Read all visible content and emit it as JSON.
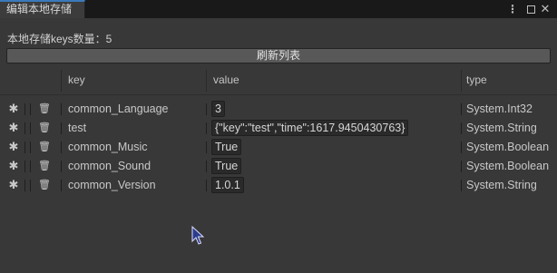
{
  "window": {
    "tab_title": "编辑本地存储",
    "controls": {
      "menu": "⋮",
      "maximize": "□",
      "close": "✕"
    }
  },
  "summary": {
    "count_text": "本地存储keys数量：5"
  },
  "toolbar": {
    "refresh_label": "刷新列表"
  },
  "table": {
    "headers": {
      "key": "key",
      "value": "value",
      "type": "type"
    },
    "rows": [
      {
        "key": "common_Language",
        "value": "3",
        "type": "System.Int32"
      },
      {
        "key": "test",
        "value": "{\"key\":\"test\",\"time\":1617.9450430763}",
        "type": "System.String"
      },
      {
        "key": "common_Music",
        "value": "True",
        "type": "System.Boolean"
      },
      {
        "key": "common_Sound",
        "value": "True",
        "type": "System.Boolean"
      },
      {
        "key": "common_Version",
        "value": "1.0.1",
        "type": "System.String"
      }
    ]
  },
  "icons": {
    "edit": "gear-icon",
    "delete": "trash-icon"
  },
  "colors": {
    "background": "#383838",
    "tab_accent": "#3a79bb",
    "button": "#585858",
    "field": "#2a2a2a"
  }
}
